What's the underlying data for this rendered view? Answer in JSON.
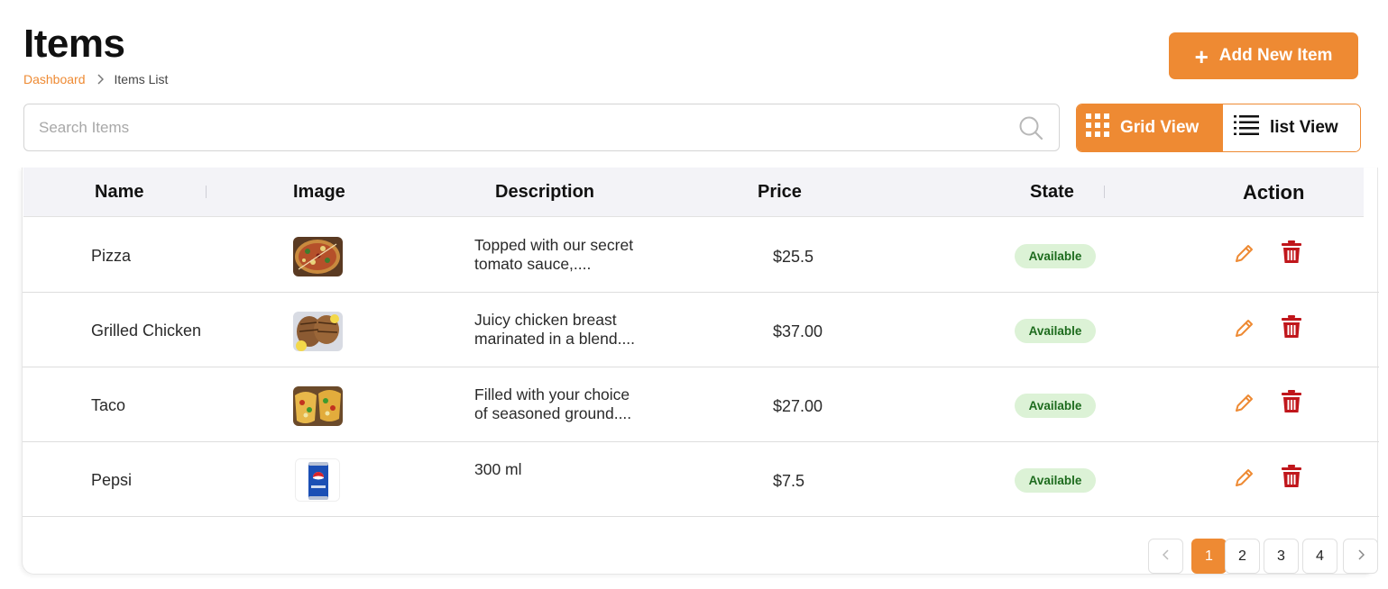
{
  "header": {
    "title": "Items",
    "breadcrumb": {
      "home": "Dashboard",
      "current": "Items List"
    },
    "add_button_label": "Add New Item"
  },
  "search": {
    "placeholder": "Search Items",
    "value": ""
  },
  "view_toggle": {
    "grid_label": "Grid View",
    "list_label": "list View",
    "active": "grid"
  },
  "table": {
    "columns": [
      "Name",
      "Image",
      "Description",
      "Price",
      "State",
      "Action"
    ],
    "rows": [
      {
        "name": "Pizza",
        "image": "pizza-photo",
        "desc_line1": "Topped with our secret",
        "desc_line2": "tomato sauce,....",
        "price": "$25.5",
        "state": "Available"
      },
      {
        "name": "Grilled Chicken",
        "image": "grilled-chicken-photo",
        "desc_line1": "Juicy chicken breast",
        "desc_line2": "marinated in a blend....",
        "price": "$37.00",
        "state": "Available"
      },
      {
        "name": "Taco",
        "image": "taco-photo",
        "desc_line1": "Filled with your choice",
        "desc_line2": "of seasoned ground....",
        "price": "$27.00",
        "state": "Available"
      },
      {
        "name": "Pepsi",
        "image": "pepsi-can-photo",
        "desc_line1": "300 ml",
        "desc_line2": "",
        "price": "$7.5",
        "state": "Available"
      }
    ]
  },
  "pagination": {
    "pages": [
      "1",
      "2",
      "3",
      "4"
    ],
    "current": "1"
  },
  "colors": {
    "accent": "#ee8a33",
    "delete": "#c0161b",
    "badge_bg": "#dcf2d6",
    "badge_text": "#1d6b1d"
  }
}
